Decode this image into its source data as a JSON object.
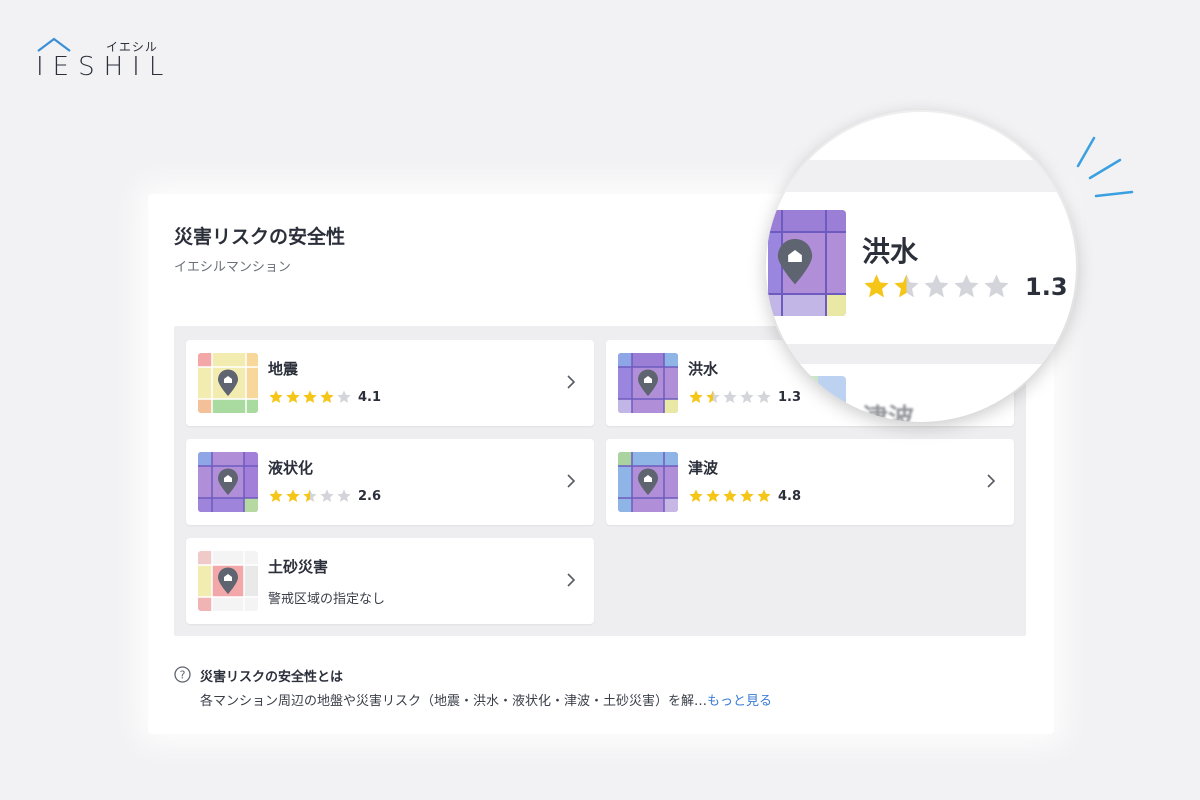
{
  "logo": {
    "kana": "イエシル",
    "word": "IESHIL",
    "icon": "house-roof-icon"
  },
  "colors": {
    "star_filled": "#f5c518",
    "star_empty": "#d4d5da",
    "link": "#3a7bd5",
    "logo_roof": "#3a8fd6"
  },
  "section": {
    "title": "災害リスクの安全性",
    "subtitle": "イエシルマンション"
  },
  "items": [
    {
      "name": "地震",
      "rating": 4.1,
      "score_text": "4.1",
      "stars_filled": 4,
      "stars_half": 0,
      "icon": "map-pin-home-icon",
      "map_palette": "earthquake"
    },
    {
      "name": "洪水",
      "rating": 1.3,
      "score_text": "1.3",
      "stars_filled": 1,
      "stars_half": 1,
      "icon": "map-pin-home-icon",
      "map_palette": "flood"
    },
    {
      "name": "液状化",
      "rating": 2.6,
      "score_text": "2.6",
      "stars_filled": 2,
      "stars_half": 1,
      "icon": "map-pin-home-icon",
      "map_palette": "liquefaction"
    },
    {
      "name": "津波",
      "rating": 4.8,
      "score_text": "4.8",
      "stars_filled": 5,
      "stars_half": 0,
      "icon": "map-pin-home-icon",
      "map_palette": "tsunami"
    },
    {
      "name": "土砂災害",
      "description": "警戒区域の指定なし",
      "icon": "map-pin-home-icon",
      "map_palette": "landslide"
    }
  ],
  "info": {
    "icon": "question-circle-icon",
    "title": "災害リスクの安全性とは",
    "body": "各マンション周辺の地盤や災害リスク（地震・洪水・液状化・津波・土砂災害）を解…",
    "more_label": "もっと見る"
  },
  "magnifier": {
    "name": "洪水",
    "score_text": "1.3",
    "rating": 1.3,
    "stars_filled": 1,
    "stars_half": 1,
    "peek_text": "津波"
  }
}
